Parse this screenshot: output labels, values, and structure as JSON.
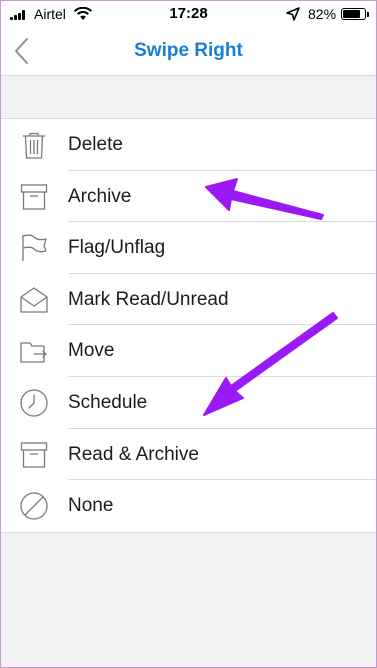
{
  "status_bar": {
    "carrier": "Airtel",
    "time": "17:28",
    "battery": "82%",
    "battery_level": 0.82
  },
  "nav": {
    "title": "Swipe Right"
  },
  "options": [
    {
      "label": "Delete",
      "icon": "trash-icon"
    },
    {
      "label": "Archive",
      "icon": "archive-box-icon"
    },
    {
      "label": "Flag/Unflag",
      "icon": "flag-icon"
    },
    {
      "label": "Mark Read/Unread",
      "icon": "envelope-open-icon"
    },
    {
      "label": "Move",
      "icon": "folder-move-icon"
    },
    {
      "label": "Schedule",
      "icon": "clock-icon"
    },
    {
      "label": "Read & Archive",
      "icon": "archive-box-icon"
    },
    {
      "label": "None",
      "icon": "none-circle-icon"
    }
  ],
  "colors": {
    "accent": "#1a7fd4",
    "annotation_arrow": "#9b19f5",
    "icon": "#7a7a7a"
  }
}
